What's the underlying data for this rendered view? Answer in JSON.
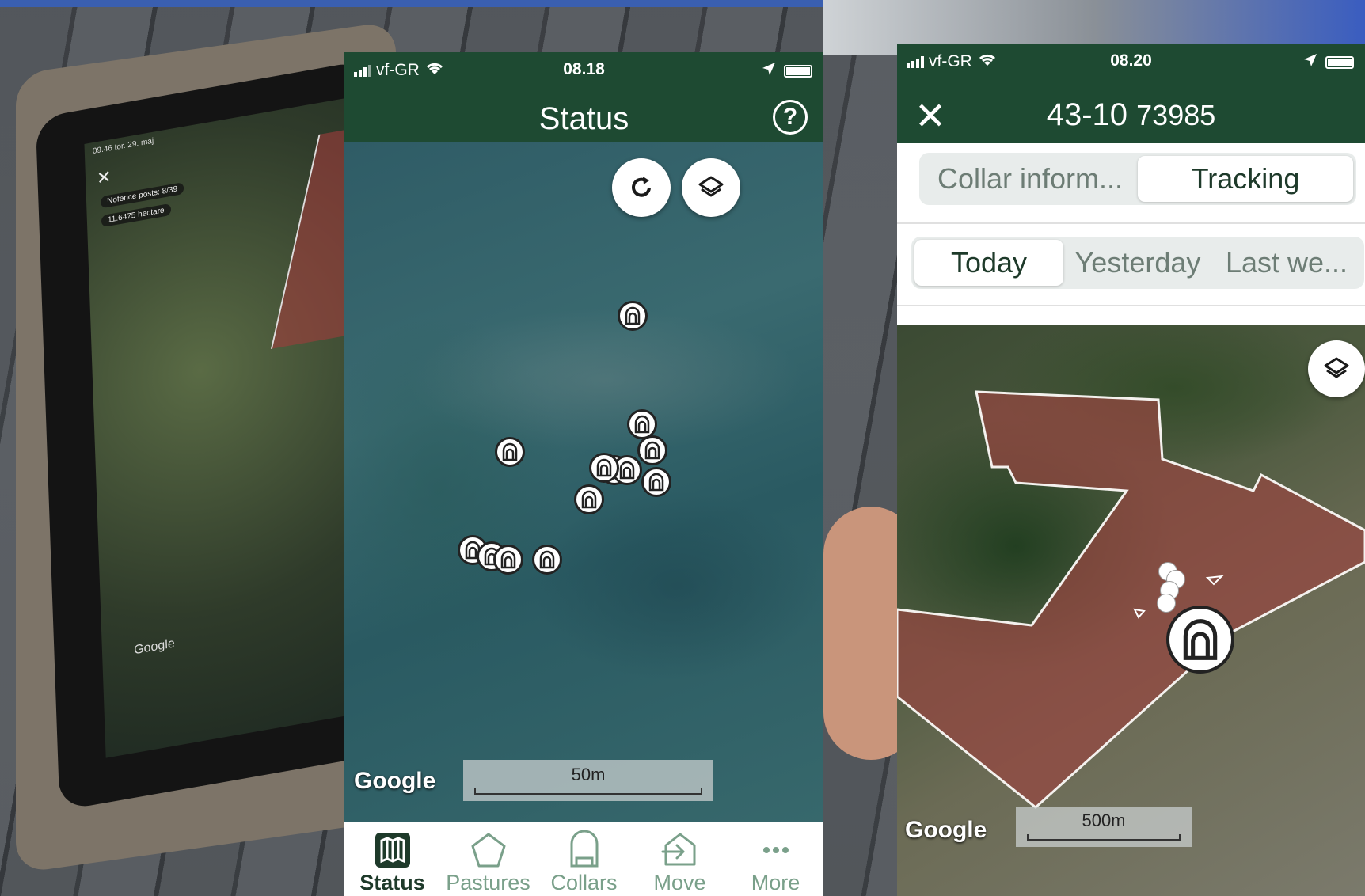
{
  "phone1": {
    "status_bar": {
      "carrier": "vf-GR",
      "time": "08.18"
    },
    "app_bar": {
      "title": "Status"
    },
    "map": {
      "google_label": "Google",
      "scale_label": "50m",
      "collar_pin_count": 13
    },
    "tabs": [
      {
        "label": "Status",
        "icon": "map-icon",
        "active": true
      },
      {
        "label": "Pastures",
        "icon": "pentagon-icon",
        "active": false
      },
      {
        "label": "Collars",
        "icon": "collar-icon",
        "active": false
      },
      {
        "label": "Move",
        "icon": "move-arrow-icon",
        "active": false
      },
      {
        "label": "More",
        "icon": "more-dots-icon",
        "active": false
      }
    ]
  },
  "phone2": {
    "status_bar": {
      "carrier": "vf-GR",
      "time": "08.20"
    },
    "app_bar": {
      "title_main": "43-10",
      "title_id": "73985"
    },
    "segment_main": {
      "options": [
        "Collar inform...",
        "Tracking"
      ],
      "selected": "Tracking"
    },
    "segment_period": {
      "options": [
        "Today",
        "Yesterday",
        "Last we..."
      ],
      "selected": "Today"
    },
    "map": {
      "google_label": "Google",
      "scale_label": "500m"
    }
  },
  "tablet": {
    "time_text": "09.46  tor. 29. maj",
    "chip_posts": "Nofence posts: 8/39",
    "chip_area": "11.6475 hectare",
    "google_label": "Google"
  },
  "colors": {
    "brand_green": "#1e4a32",
    "tab_inactive": "#7aa08a",
    "pasture_fill": "#9b4a48"
  }
}
